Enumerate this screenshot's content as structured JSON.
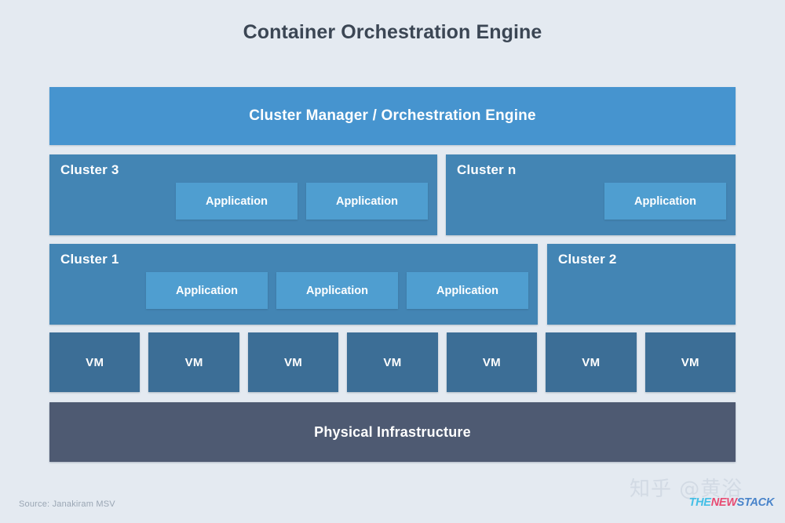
{
  "title": "Container Orchestration Engine",
  "colors": {
    "background": "#e4eaf1",
    "title_text": "#3b4654",
    "orchestration_bar": "#4694cf",
    "cluster_box": "#4385b4",
    "application_box": "#4f9ed0",
    "vm_box": "#3c6e96",
    "physical_infrastructure": "#4e5a72",
    "logo_the": "#29b8e5",
    "logo_new": "#e8315e",
    "logo_stack": "#2f73c4",
    "watermark": "#d2dae4"
  },
  "orchestration": {
    "label": "Cluster Manager / Orchestration Engine"
  },
  "cluster_rows": [
    {
      "clusters": [
        {
          "label": "Cluster 3",
          "applications": [
            "Application",
            "Application"
          ]
        },
        {
          "label": "Cluster n",
          "applications": [
            "Application"
          ]
        }
      ]
    },
    {
      "clusters": [
        {
          "label": "Cluster 1",
          "applications": [
            "Application",
            "Application",
            "Application"
          ]
        },
        {
          "label": "Cluster 2",
          "applications": []
        }
      ]
    }
  ],
  "vm_layer": {
    "count": 7,
    "labels": [
      "VM",
      "VM",
      "VM",
      "VM",
      "VM",
      "VM",
      "VM"
    ]
  },
  "infrastructure": {
    "label": "Physical Infrastructure"
  },
  "footer": {
    "source": "Source: Janakiram MSV",
    "watermark": "知乎 @黄浴",
    "logo": {
      "part1": "THE",
      "part2": "NEW",
      "part3": "STACK"
    }
  },
  "layer_order": [
    "Cluster Manager / Orchestration Engine",
    "Clusters (3, n)",
    "Clusters (1, 2)",
    "Virtual Machines",
    "Physical Infrastructure"
  ]
}
